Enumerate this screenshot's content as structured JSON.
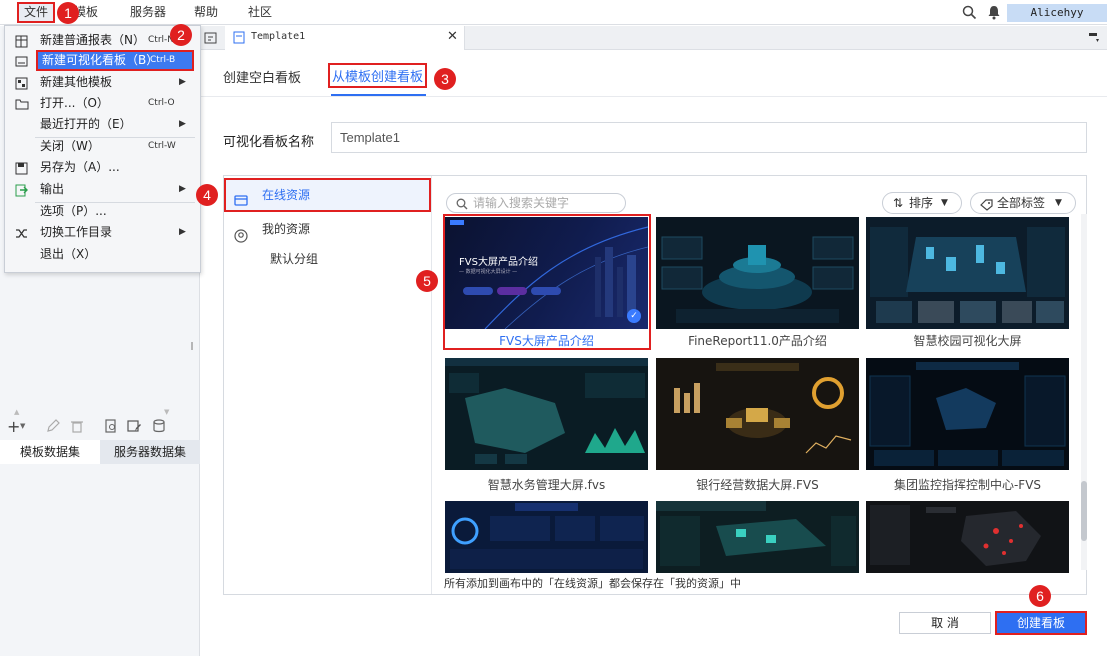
{
  "menubar": {
    "file": "文件",
    "template": "模板",
    "server": "服务器",
    "help": "帮助",
    "community": "社区",
    "user": "Alicehyy"
  },
  "file_menu": {
    "items": [
      {
        "label": "新建普通报表（N）",
        "shortcut": "Ctrl-N",
        "icon": "grid-icon"
      },
      {
        "label": "新建可视化看板（B）",
        "shortcut": "Ctrl-B",
        "icon": "dashboard-icon"
      },
      {
        "label": "新建其他模板",
        "icon": "template-icon"
      },
      {
        "label": "打开...（O）",
        "shortcut": "Ctrl-O",
        "icon": "folder-icon"
      },
      {
        "label": "最近打开的（E）"
      },
      {
        "label": "关闭（W）",
        "shortcut": "Ctrl-W"
      },
      {
        "label": "另存为（A）...",
        "icon": "save-as-icon"
      },
      {
        "label": "输出",
        "icon": "export-icon"
      },
      {
        "label": "选项（P）..."
      },
      {
        "label": "切换工作目录",
        "icon": "switch-icon"
      },
      {
        "label": "退出（X）"
      }
    ]
  },
  "left_panel": {
    "tabs": [
      "模板数据集",
      "服务器数据集"
    ]
  },
  "document_tab": {
    "title": "Template1"
  },
  "dialog": {
    "mode_tabs": [
      "创建空白看板",
      "从模板创建看板"
    ],
    "name_label": "可视化看板名称",
    "name_value": "Template1",
    "resources": [
      "在线资源",
      "我的资源",
      "默认分组"
    ],
    "search_placeholder": "请输入搜索关键字",
    "sort_label": "排序",
    "tags_label": "全部标签",
    "templates": [
      {
        "name": "FVS大屏产品介绍",
        "selected": true
      },
      {
        "name": "FineReport11.0产品介绍",
        "selected": false
      },
      {
        "name": "智慧校园可视化大屏",
        "selected": false
      },
      {
        "name": "智慧水务管理大屏.fvs",
        "selected": false
      },
      {
        "name": "银行经营数据大屏.FVS",
        "selected": false
      },
      {
        "name": "集团监控指挥控制中心-FVS",
        "selected": false
      },
      {
        "name": "",
        "selected": false
      },
      {
        "name": "",
        "selected": false
      },
      {
        "name": "",
        "selected": false
      }
    ],
    "thumb_titles": {
      "fvs_title": "FVS大屏产品介绍",
      "fvs_subtitle": "— 数据可视化大屏设计 —"
    },
    "footnote": "所有添加到画布中的「在线资源」都会保存在「我的资源」中",
    "cancel": "取 消",
    "create": "创建看板"
  },
  "badges": [
    "1",
    "2",
    "3",
    "4",
    "5",
    "6"
  ],
  "colors": {
    "accent": "#2e6ff2",
    "annotation": "#e02020",
    "thumb_bg": "#0a1a2e"
  }
}
